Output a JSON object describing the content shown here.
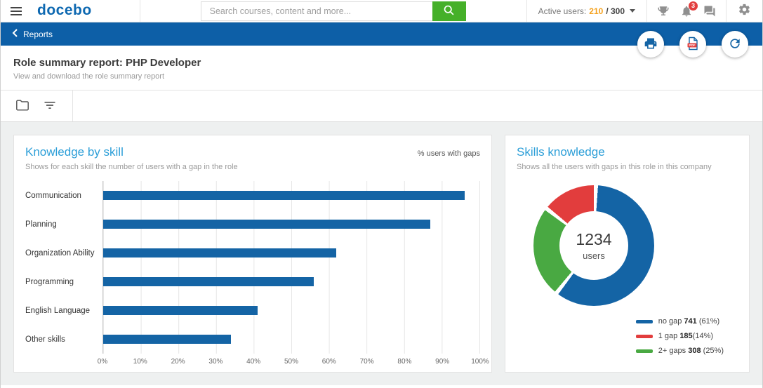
{
  "topbar": {
    "logo": "docebo",
    "search_placeholder": "Search courses, content and more...",
    "active_users_label": "Active users:",
    "active_users_current": "210",
    "active_users_total": "/ 300",
    "notifications_badge": "3"
  },
  "breadcrumb": "Reports",
  "page": {
    "title": "Role summary report: PHP Developer",
    "subtitle": "View and download the role summary report"
  },
  "left_card": {
    "title": "Knowledge by skill",
    "subtitle": "Shows for each skill the number of users with a gap in the role"
  },
  "right_card": {
    "title": "Skills knowledge",
    "subtitle": "Shows all the users with gaps in this role in this company"
  },
  "chart_data": [
    {
      "type": "bar",
      "orientation": "horizontal",
      "title": "Knowledge by skill",
      "annotation": "% users with gaps",
      "categories": [
        "Communication",
        "Planning",
        "Organization Ability",
        "Programming",
        "English Language",
        "Other skills"
      ],
      "values": [
        96,
        87,
        62,
        56,
        41,
        34
      ],
      "unit": "%",
      "xlim": [
        0,
        100
      ],
      "x_ticks": [
        "0%",
        "10%",
        "20%",
        "30%",
        "40%",
        "50%",
        "60%",
        "70%",
        "80%",
        "90%",
        "100%"
      ],
      "grid": "vertical",
      "bar_color": "#1464a5"
    },
    {
      "type": "pie",
      "subtype": "donut",
      "title": "Skills knowledge",
      "center_value": "1234",
      "center_caption": "users",
      "slices_clockwise_from_top": [
        {
          "name": "no gap",
          "value": 741,
          "pct": 61,
          "color": "#1464a5"
        },
        {
          "name": "2+ gaps",
          "value": 308,
          "pct": 25,
          "color": "#49a942"
        },
        {
          "name": "1 gap",
          "value": 185,
          "pct": 14,
          "color": "#e23d3d"
        }
      ],
      "legend": [
        {
          "name": "no gap ",
          "count": "741",
          "pct": " (61%)",
          "color": "#1464a5"
        },
        {
          "name": "1 gap ",
          "count": "185",
          "pct": "(14%)",
          "color": "#e23d3d"
        },
        {
          "name": "2+ gaps ",
          "count": "308",
          "pct": " (25%)",
          "color": "#49a942"
        }
      ],
      "legend_position": "bottom-right"
    }
  ],
  "colors": {
    "header_blue": "#0d5fa7",
    "accent_green": "#45b029",
    "card_title_blue": "#2d9fd8",
    "bar_blue": "#1464a5",
    "slice_red": "#e23d3d",
    "slice_green": "#49a942",
    "active_users_orange": "#f5a11c"
  }
}
